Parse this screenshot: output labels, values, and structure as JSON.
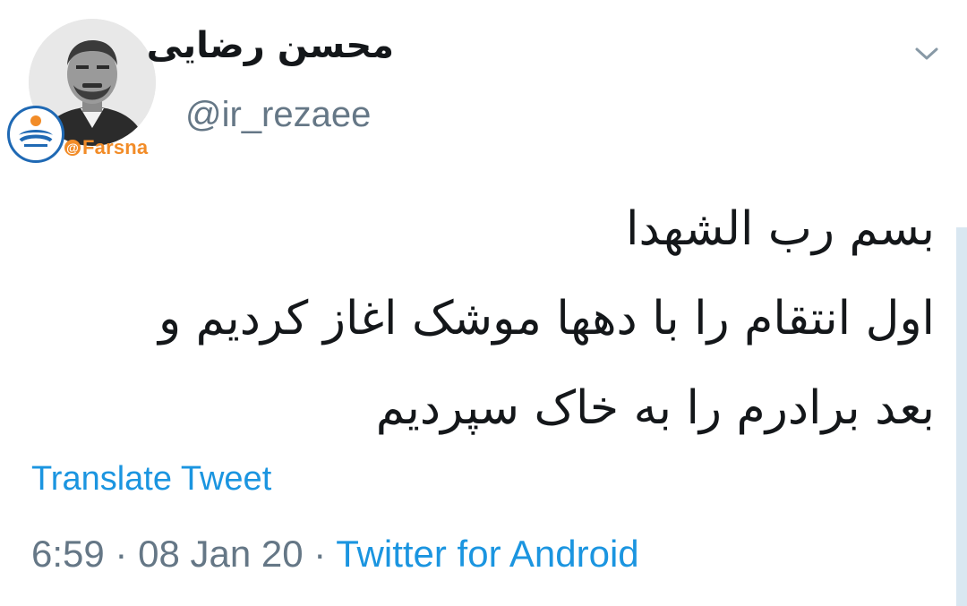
{
  "user": {
    "display_name": "محسن رضایی",
    "handle": "@ir_rezaee",
    "avatar_icon": "profile-photo"
  },
  "watermark": {
    "brand": "Farsna",
    "at": "@",
    "logo_icon": "fars-news-logo",
    "brand_color": "#f28c28",
    "logo_color": "#1f69b4"
  },
  "menu": {
    "icon": "chevron-down-icon"
  },
  "tweet": {
    "lines": [
      "بسم رب الشهدا",
      "اول انتقام را با دهها موشک اغاز کردیم و",
      "بعد برادرم را به خاک سپردیم"
    ]
  },
  "translate_label": "Translate Tweet",
  "meta": {
    "time": "6:59",
    "separator": "·",
    "date": "08 Jan 20",
    "source": "Twitter for Android"
  },
  "colors": {
    "link": "#1b95e0",
    "secondary_text": "#657786",
    "primary_text": "#14171a"
  }
}
